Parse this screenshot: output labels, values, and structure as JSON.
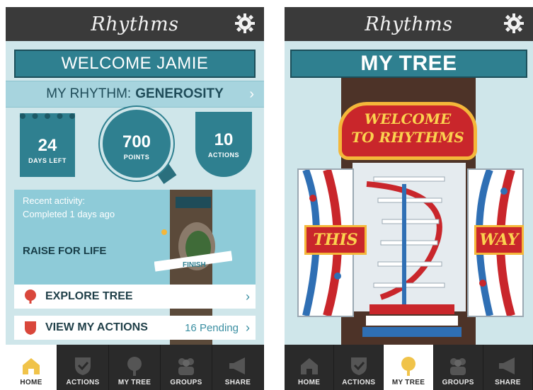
{
  "left": {
    "app_title": "Rhythms",
    "welcome": "WELCOME JAMIE",
    "rhythm_prefix": "MY RHYTHM:",
    "rhythm_name": "GENEROSITY",
    "stats": {
      "days_value": "24",
      "days_label": "DAYS LEFT",
      "points_value": "700",
      "points_label": "POINTS",
      "actions_value": "10",
      "actions_label": "ACTIONS"
    },
    "activity": {
      "recent_label": "Recent activity:",
      "completed": "Completed 1 days ago",
      "event": "RAISE FOR LIFE"
    },
    "explore_label": "EXPLORE TREE",
    "view_actions_label": "VIEW MY ACTIONS",
    "pending": "16 Pending",
    "finish_text": "FINISH"
  },
  "right": {
    "app_title": "Rhythms",
    "page_title": "MY TREE",
    "marquee_line1": "WELCOME",
    "marquee_line2": "TO RHYTHMS",
    "sign_left": "THIS",
    "sign_right": "WAY"
  },
  "tabs": [
    {
      "label": "HOME",
      "icon": "home-icon"
    },
    {
      "label": "ACTIONS",
      "icon": "shield-check-icon"
    },
    {
      "label": "MY TREE",
      "icon": "tree-icon"
    },
    {
      "label": "GROUPS",
      "icon": "group-icon"
    },
    {
      "label": "SHARE",
      "icon": "megaphone-icon"
    }
  ],
  "active_tab_left": "HOME",
  "active_tab_right": "MY TREE",
  "colors": {
    "teal": "#2f8090",
    "light_teal": "#cfe6ea",
    "dark": "#2a2a2a",
    "accent_red": "#c9262b",
    "accent_gold": "#f4b73a"
  }
}
